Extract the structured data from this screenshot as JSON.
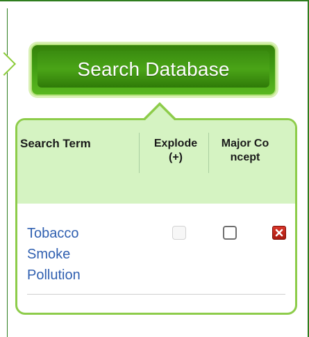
{
  "search_button": {
    "label": "Search Database"
  },
  "table": {
    "columns": {
      "search_term": "Search Term",
      "explode_line1": "Explode",
      "explode_line2": "(+)",
      "major_line1": "Major Co",
      "major_line2": "ncept"
    },
    "rows": [
      {
        "term_lines": [
          "Tobacco",
          "Smoke",
          "Pollution"
        ],
        "explode_checked": false,
        "explode_disabled": true,
        "major_checked": false,
        "remove_icon": "close-x-icon"
      }
    ]
  },
  "colors": {
    "button_green": "#3f9a12",
    "panel_border": "#8dcc4a",
    "header_band": "#d5f3c2",
    "link_blue": "#2f5fb0",
    "remove_red": "#c8281c"
  }
}
